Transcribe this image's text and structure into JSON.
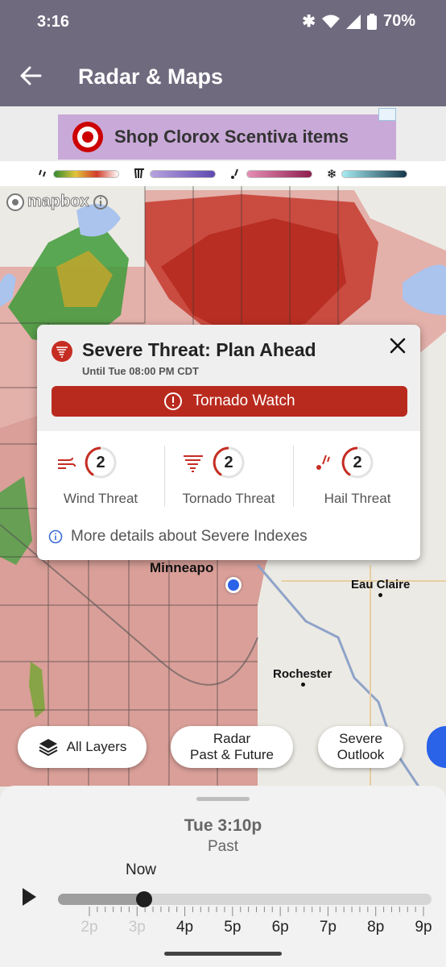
{
  "status_bar": {
    "time": "3:16",
    "battery": "70%"
  },
  "app_bar": {
    "title": "Radar & Maps"
  },
  "ad": {
    "text": "Shop Clorox Scentiva items"
  },
  "legend": [
    {
      "icon": "rain-icon",
      "colors": [
        "#2e8b2e",
        "#e2c53a",
        "#d23c2a",
        "#ffffff"
      ]
    },
    {
      "icon": "mixed-precip-icon",
      "colors": [
        "#b7a3e0",
        "#5e48b0"
      ]
    },
    {
      "icon": "sleet-icon",
      "colors": [
        "#e58fb5",
        "#8e1d4d"
      ]
    },
    {
      "icon": "snow-icon",
      "colors": [
        "#a6ecf2",
        "#14374b"
      ]
    }
  ],
  "map": {
    "attribution": "mapbox",
    "places": [
      "Minneapo",
      "Eau Claire",
      "Rochester"
    ]
  },
  "popup": {
    "title": "Severe Threat: Plan Ahead",
    "subtitle": "Until Tue 08:00 PM CDT",
    "alert_label": "Tornado Watch",
    "threats": [
      {
        "label": "Wind Threat",
        "level": "2"
      },
      {
        "label": "Tornado Threat",
        "level": "2"
      },
      {
        "label": "Hail Threat",
        "level": "2"
      }
    ],
    "details_link": "More details about Severe Indexes"
  },
  "layer_buttons": {
    "all_layers": "All Layers",
    "radar_line1": "Radar",
    "radar_line2": "Past & Future",
    "severe_line1": "Severe",
    "severe_line2": "Outlook"
  },
  "timeline": {
    "time": "Tue 3:10p",
    "mode": "Past",
    "now_label": "Now",
    "position": 0.23,
    "labels": [
      "2p",
      "3p",
      "4p",
      "5p",
      "6p",
      "7p",
      "8p",
      "9p"
    ]
  },
  "colors": {
    "app_bar": "#6f6a7e",
    "alert_red": "#b92a1e",
    "threat_red": "#c62d22",
    "location_blue": "#2a62e8"
  }
}
